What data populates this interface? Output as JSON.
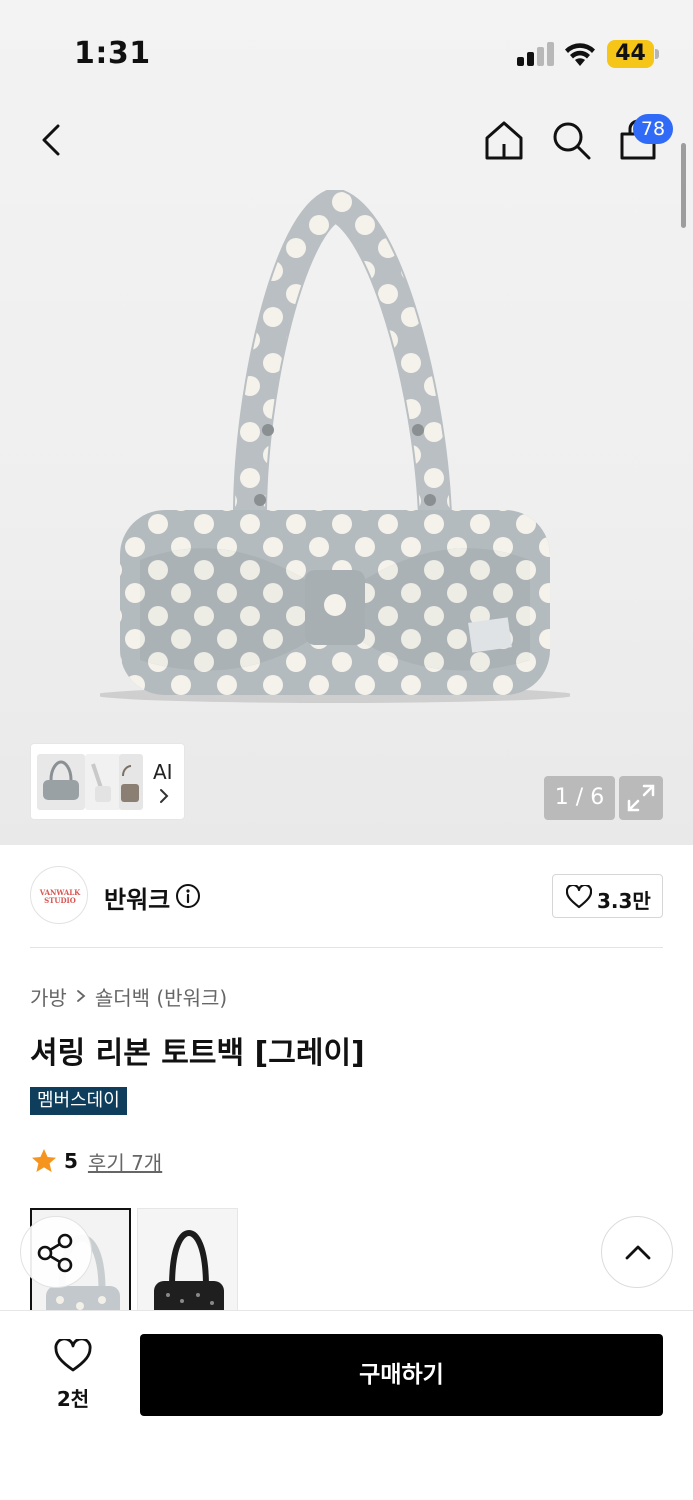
{
  "status_bar": {
    "time": "1:31",
    "battery": "44",
    "battery_color": "#f5c518"
  },
  "header": {
    "back_icon": "chevron-left-icon",
    "home_icon": "home-icon",
    "search_icon": "search-icon",
    "cart_icon": "shopping-bag-icon",
    "cart_count": "78",
    "badge_color": "#2f6bf6"
  },
  "gallery": {
    "ai_label": "AI",
    "page_indicator": "1 / 6",
    "expand_icon": "expand-icon"
  },
  "brand": {
    "logo_text_line1": "VANWALK",
    "logo_text_line2": "STUDIO",
    "name": "반워크",
    "likes": "3.3만"
  },
  "breadcrumb": {
    "items": [
      "가방",
      "숄더백 (반워크)"
    ]
  },
  "product": {
    "title": "셔링 리본 토트백 [그레이]",
    "badge": "멤버스데이",
    "badge_color": "#0f3d5c",
    "rating": "5",
    "reviews": "후기 7개",
    "star_color": "#f5951d"
  },
  "bottom_bar": {
    "wish_count": "2천",
    "buy_label": "구매하기"
  }
}
